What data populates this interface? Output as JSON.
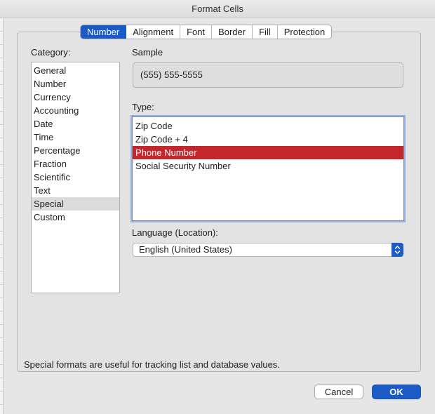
{
  "window": {
    "title": "Format Cells"
  },
  "tabs": [
    {
      "label": "Number",
      "active": true
    },
    {
      "label": "Alignment"
    },
    {
      "label": "Font"
    },
    {
      "label": "Border"
    },
    {
      "label": "Fill"
    },
    {
      "label": "Protection"
    }
  ],
  "category": {
    "label": "Category:",
    "selected": "Special",
    "items": [
      "General",
      "Number",
      "Currency",
      "Accounting",
      "Date",
      "Time",
      "Percentage",
      "Fraction",
      "Scientific",
      "Text",
      "Special",
      "Custom"
    ]
  },
  "sample": {
    "label": "Sample",
    "value": "(555) 555-5555"
  },
  "type": {
    "label": "Type:",
    "selected": "Phone Number",
    "items": [
      "Zip Code",
      "Zip Code + 4",
      "Phone Number",
      "Social Security Number"
    ]
  },
  "language": {
    "label": "Language (Location):",
    "value": "English (United States)",
    "icon": "chevron-up-down-icon"
  },
  "footnote": "Special formats are useful for tracking list and database values.",
  "buttons": {
    "cancel": "Cancel",
    "ok": "OK"
  },
  "colors": {
    "accent": "#1a5bc6",
    "selection": "#c4262e"
  }
}
